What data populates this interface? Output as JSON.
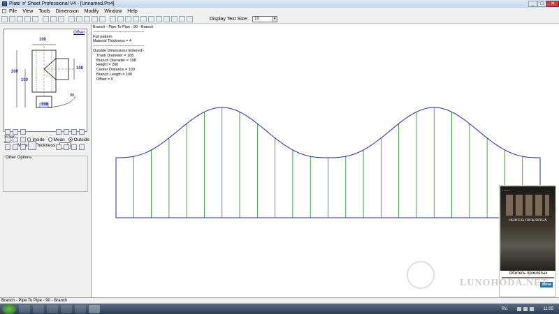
{
  "window": {
    "title": "Plate 'n' Sheet Professional V4 - [Unnamed.Pn4]",
    "controls": [
      "_",
      "□",
      "✕"
    ]
  },
  "menu": [
    "File",
    "View",
    "Tools",
    "Dimension",
    "Modify",
    "Window",
    "Help"
  ],
  "toolbar": {
    "display_text_size_label": "Display Text Size:",
    "display_text_size_value": "10"
  },
  "left_panel": {
    "offset_link": "Offset",
    "dims": {
      "top": "100",
      "left_height": "200",
      "left_inner": "100",
      "right": "108",
      "bottom": "108",
      "angle": "90"
    },
    "sizes_label": "Sizes are:",
    "size_options": [
      "Inside",
      "Mean",
      "Outside"
    ],
    "selected_size": "Outside",
    "material_thickness_label": "Material Thickness",
    "material_thickness_value": "4",
    "other_options_label": "Other Options"
  },
  "info_text": {
    "line1": "Branch - Pipe To Pipe - 90 - Branch",
    "sep": "----------------------------------------",
    "line2": "Full pattern",
    "line3": "Material Thickness = 4",
    "sep2": "----------------------------------------",
    "line4": "Outside Dimensions Entered:-",
    "dims": [
      "Trunk Diameter = 108",
      "Branch Diameter = 108",
      "Height = 200",
      "Center Distance = 100",
      "Branch Length = 100",
      "Offset = 0"
    ]
  },
  "pattern_colors": {
    "outline": "#1f2aa8",
    "lines": "#1e8a1e"
  },
  "status_bar": {
    "text": "Branch - Pipe To Pipe - 90 - Branch"
  },
  "ad": {
    "movie_title_ru": "ОБИТЕЛЬ ПРОКЛЯТЫХ",
    "caption": "Обитель проклятых",
    "brand": "zona"
  },
  "watermark": {
    "text": "LUNOHODA.NET"
  },
  "taskbar": {
    "lang": "RU",
    "time": "11:05"
  }
}
